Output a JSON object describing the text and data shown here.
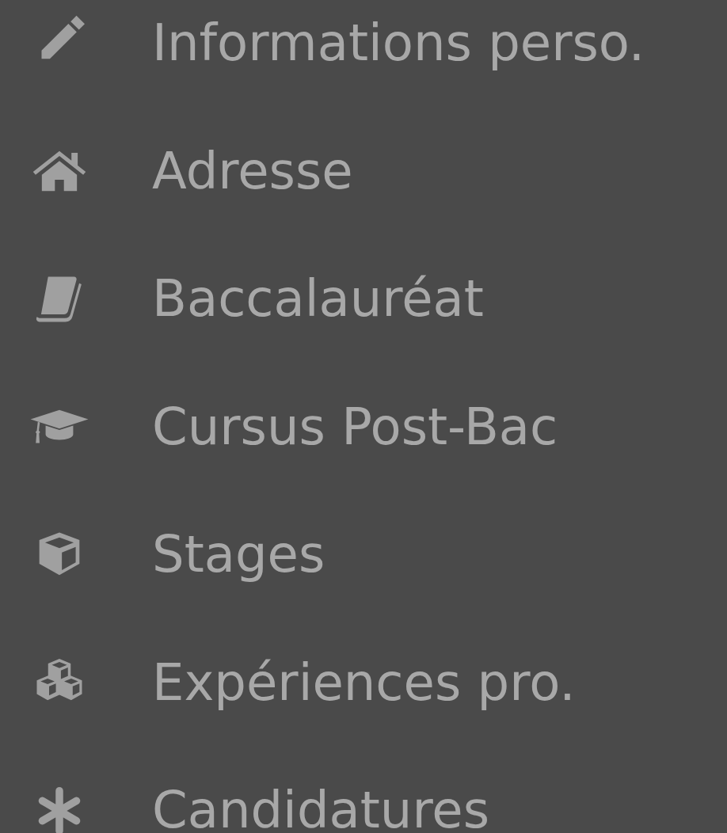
{
  "menu": {
    "items": [
      {
        "label": "Informations perso.",
        "kind": "pencil"
      },
      {
        "label": "Adresse",
        "kind": "home"
      },
      {
        "label": "Baccalauréat",
        "kind": "book"
      },
      {
        "label": "Cursus Post-Bac",
        "kind": "cap"
      },
      {
        "label": "Stages",
        "kind": "cube"
      },
      {
        "label": "Expériences pro.",
        "kind": "cubes"
      },
      {
        "label": "Candidatures",
        "kind": "asterisk"
      }
    ]
  }
}
